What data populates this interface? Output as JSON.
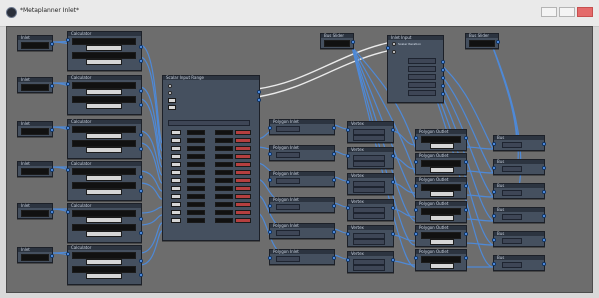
{
  "window": {
    "title": "*Metaplanner Inlet*",
    "buttons": {
      "minimize": "",
      "maximize": "",
      "close": ""
    }
  },
  "canvas": {
    "labels": {
      "param_left": "Inlet",
      "param_calc": "Calculator",
      "big_node": "Scalar Input Range",
      "right_node": "Inlet Input",
      "right_node_sub": "Scalar Iteration",
      "top_param_1": "Bus Slider",
      "top_param_2": "Bus Slider",
      "top_param_3": "Bus Slider",
      "top_param_4": "Bus Slider",
      "stage_a": "Polygon Inlet",
      "stage_b": "Vertex",
      "stage_c": "Polygon Outlet",
      "stage_d": "Bus"
    },
    "colors": {
      "node_bg": "#45505f",
      "node_header": "#2c3440",
      "canvas_bg": "#6d6d6d",
      "wire_blue": "#4e89d7",
      "wire_white": "#eaeaea",
      "port": "#5fa2ff"
    },
    "icons": {
      "app": "app-icon",
      "close": "close-icon",
      "minimize": "minimize-icon",
      "maximize": "maximize-icon"
    }
  }
}
